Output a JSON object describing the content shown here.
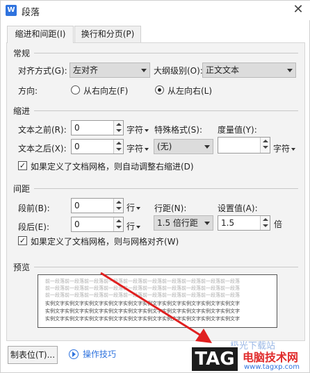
{
  "window": {
    "title": "段落",
    "app_icon": "W",
    "close_glyph": "✕"
  },
  "tabs": [
    {
      "label": "缩进和间距(I)",
      "active": true
    },
    {
      "label": "换行和分页(P)",
      "active": false
    }
  ],
  "general": {
    "section": "常规",
    "align_label": "对齐方式(G):",
    "align_value": "左对齐",
    "outline_label": "大纲级别(O):",
    "outline_value": "正文文本",
    "direction_label": "方向:",
    "rtl_label": "从右向左(F)",
    "ltr_label": "从左向右(L)",
    "direction_selected": "ltr"
  },
  "indent": {
    "section": "缩进",
    "before_label": "文本之前(R):",
    "before_value": "0",
    "before_unit": "字符",
    "after_label": "文本之后(X):",
    "after_value": "0",
    "after_unit": "字符",
    "special_label": "特殊格式(S):",
    "special_value": "(无)",
    "measure_label": "度量值(Y):",
    "measure_value": "",
    "measure_unit": "字符",
    "auto_adjust_label": "如果定义了文档网格，则自动调整右缩进(D)",
    "auto_adjust_checked": true
  },
  "spacing": {
    "section": "间距",
    "before_label": "段前(B):",
    "before_value": "0",
    "before_unit": "行",
    "after_label": "段后(E):",
    "after_value": "0",
    "after_unit": "行",
    "line_label": "行距(N):",
    "line_value": "1.5 倍行距",
    "setting_label": "设置值(A):",
    "setting_value": "1.5",
    "setting_unit": "倍",
    "snap_label": "如果定义了文档网格，则与网格对齐(W)",
    "snap_checked": true
  },
  "preview": {
    "section": "预览",
    "prev_line": "前一段落前一段落前一段落前一段落前一段落前一段落前一段落前一段落前一段落前一段落",
    "sample_line": "实例文字实例文字实例文字实例文字实例文字实例文字实例文字实例文字实例文字实例文字"
  },
  "footer": {
    "tabs_button": "制表位(T)...",
    "tips_link": "操作技巧"
  },
  "watermark": {
    "tag": "TAG",
    "site_name": "电脑技术网",
    "site_url": "www.tagxp.com",
    "top_text": "极光下载站"
  }
}
